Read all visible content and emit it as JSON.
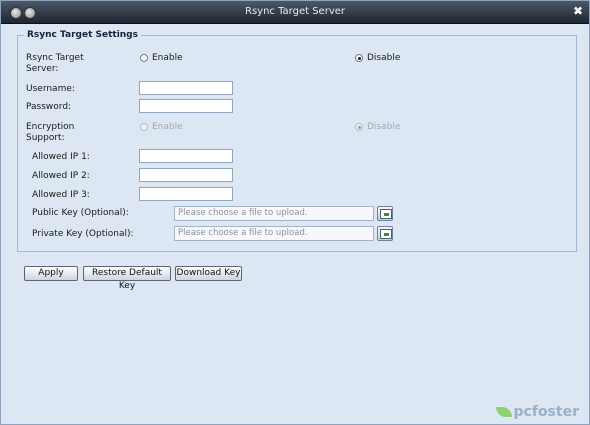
{
  "window": {
    "title": "Rsync Target Server",
    "close_glyph": "✖"
  },
  "section": {
    "legend": "Rsync Target Settings"
  },
  "server": {
    "label": "Rsync Target Server:",
    "enable": "Enable",
    "disable": "Disable",
    "selected": "Disable"
  },
  "username": {
    "label": "Username:",
    "value": ""
  },
  "password": {
    "label": "Password:",
    "value": ""
  },
  "encryption": {
    "label": "Encryption Support:",
    "enable": "Enable",
    "disable": "Disable",
    "selected": "Disable",
    "disabled": true
  },
  "allowed_ip": [
    {
      "label": "Allowed IP 1:",
      "value": ""
    },
    {
      "label": "Allowed IP 2:",
      "value": ""
    },
    {
      "label": "Allowed IP 3:",
      "value": ""
    }
  ],
  "public_key": {
    "label": "Public Key (Optional):",
    "placeholder": "Please choose a file to upload."
  },
  "private_key": {
    "label": "Private Key (Optional):",
    "placeholder": "Please choose a file to upload."
  },
  "buttons": {
    "apply": "Apply",
    "restore": "Restore Default Key",
    "download": "Download Key"
  },
  "watermark": "pcfoster",
  "colors": {
    "titlebar": "#2b3442",
    "background": "#dde7f3",
    "fieldset_border": "#a8b8cc"
  }
}
